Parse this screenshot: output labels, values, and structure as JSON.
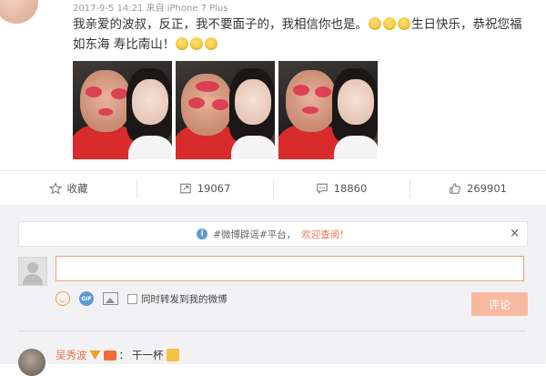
{
  "post": {
    "meta": "2017-9-5 14:21 来自 iPhone 7 Plus",
    "text_part1": "我亲爱的波叔，反正，我不要面子的，我相信你也是。",
    "text_part2": "生日快乐，恭祝您福如东海 寿比南山！"
  },
  "actions": {
    "favorite": "收藏",
    "repost_count": "19067",
    "comment_count": "18860",
    "like_count": "269901"
  },
  "notice": {
    "text": "#微博辟谣#平台，",
    "link": "欢迎查阅！",
    "close": "×"
  },
  "composer": {
    "input_value": "",
    "sync_label": "同时转发到我的微博",
    "submit_label": "评论",
    "gif_label": "GIF"
  },
  "first_comment": {
    "author": "吴秀波",
    "separator": "：",
    "text": "干一杯"
  },
  "colors": {
    "accent": "#eb7350",
    "submit_disabled": "#f8b9a0",
    "panel_bg": "#f2f2f5"
  }
}
